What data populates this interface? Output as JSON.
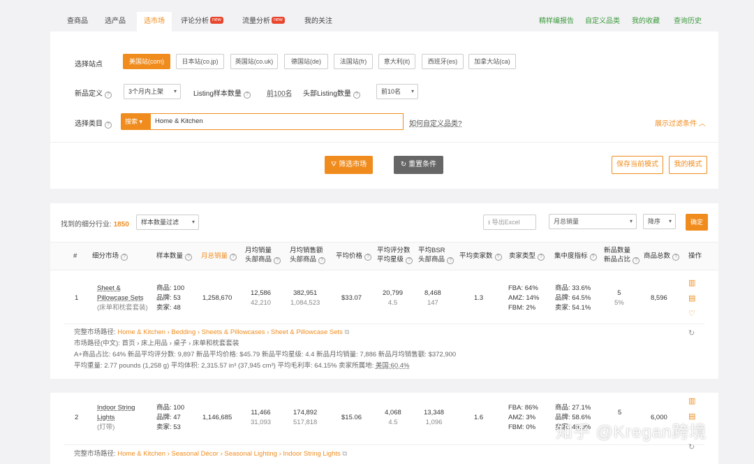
{
  "nav": {
    "tabs": [
      "查商品",
      "选产品",
      "选市场",
      "评论分析",
      "流量分析",
      "我的关注"
    ],
    "new_badge": "new",
    "links": [
      "精样编报告",
      "自定义品类",
      "我的收藏",
      "查询历史"
    ]
  },
  "filters": {
    "site_label": "选择站点",
    "sites": [
      "美国站(com)",
      "日本站(co.jp)",
      "英国站(co.uk)",
      "德国站(de)",
      "法国站(fr)",
      "意大利(it)",
      "西班牙(es)",
      "加拿大站(ca)"
    ],
    "newdef_label": "新品定义",
    "newdef_value": "3个月内上架",
    "sample_label": "Listing样本数量",
    "sample_value": "前100名",
    "head_label": "头部Listing数量",
    "head_value": "前10名",
    "category_label": "选择类目",
    "search_btn": "搜索",
    "category_value": "Home & Kitchen",
    "custom_category_link": "如何自定义品类?",
    "show_filter_link": "展示过滤条件",
    "filter_market_btn": "筛选市场",
    "reset_btn": "重置条件",
    "save_mode_btn": "保存当前模式",
    "my_mode_btn": "我的模式"
  },
  "results": {
    "found_prefix": "找到的细分行业: ",
    "found_count": "1850",
    "sample_filter": "样本数量过滤",
    "export_label": "导出Excel",
    "sort_field": "月总销量",
    "sort_order": "降序",
    "confirm_btn": "确定"
  },
  "table": {
    "headers": {
      "idx": "#",
      "market": "细分市场",
      "sample": "样本数量",
      "monthly_sales": "月总销量",
      "avg_sales_1": "月均销量",
      "avg_sales_2": "头部商品",
      "avg_rev_1": "月均销售额",
      "avg_rev_2": "头部商品",
      "avg_price": "平均价格",
      "avg_reviews_1": "平均评分数",
      "avg_reviews_2": "平均星级",
      "avg_bsr_1": "平均BSR",
      "avg_bsr_2": "头部商品",
      "avg_sellers": "平均卖家数",
      "seller_type": "卖家类型",
      "concentration": "集中度指标",
      "new_1": "新品数量",
      "new_2": "新品占比",
      "total": "商品总数",
      "action": "操作"
    },
    "rows": [
      {
        "idx": "1",
        "name_1": "Sheet &",
        "name_2": "Pillowcase Sets",
        "name_cn": "(床单和枕套套装)",
        "sample_goods": "商品: 100",
        "sample_brands": "品牌: 53",
        "sample_sellers": "卖家: 48",
        "monthly_sales": "1,258,670",
        "avg_sales": "12,586",
        "avg_sales_head": "42,210",
        "avg_rev": "382,951",
        "avg_rev_head": "1,084,523",
        "avg_price": "$33.07",
        "avg_reviews": "20,799",
        "avg_rating": "4.5",
        "avg_bsr": "8,468",
        "avg_bsr_head": "147",
        "avg_sellers": "1.3",
        "fba": "FBA: 64%",
        "amz": "AMZ: 14%",
        "fbm": "FBM: 2%",
        "conc_goods": "商品: 33.6%",
        "conc_brands": "品牌: 64.5%",
        "conc_sellers": "卖家: 54.1%",
        "new_count": "5",
        "new_ratio": "5%",
        "total": "8,596",
        "path_label": "完整市场路径: ",
        "path": "Home & Kitchen › Bedding › Sheets & Pillowcases › Sheet & Pillowcase Sets",
        "path_cn": "市场路径(中文): 首页 › 床上用品 › 桌子 › 床单和枕套套装",
        "stats_1": "A+商品占比: 64%    新品平均评分数: 9,897    新品平均价格: $45.79    新品平均星级: 4.4    新品月均销量: 7,886    新品月均销售额: $372,900",
        "stats_2": "平均重量: 2.77 pounds (1,258 g)    平均体积: 2,315.57 in³ (37,945 cm³)    平均毛利率: 64.15%    ",
        "seller_loc_label": "卖家所属地: ",
        "seller_loc": "美国:60.4%"
      },
      {
        "idx": "2",
        "name_1": "Indoor String",
        "name_2": "Lights",
        "name_cn": "(灯带)",
        "sample_goods": "商品: 100",
        "sample_brands": "品牌: 47",
        "sample_sellers": "卖家: 53",
        "monthly_sales": "1,146,685",
        "avg_sales": "11,466",
        "avg_sales_head": "31,093",
        "avg_rev": "174,892",
        "avg_rev_head": "517,818",
        "avg_price": "$15.06",
        "avg_reviews": "4,068",
        "avg_rating": "4.5",
        "avg_bsr": "13,348",
        "avg_bsr_head": "1,096",
        "avg_sellers": "1.6",
        "fba": "FBA: 86%",
        "amz": "AMZ: 3%",
        "fbm": "FBM: 0%",
        "conc_goods": "商品: 27.1%",
        "conc_brands": "品牌: 58.6%",
        "conc_sellers": "卖家: 49.0%",
        "new_count": "5",
        "total": "6,000",
        "path_label": "完整市场路径: ",
        "path": "Home & Kitchen › Seasonal Décor › Seasonal Lighting › Indoor String Lights"
      }
    ]
  },
  "watermark": "知乎 @Kregan跨境",
  "colors": {
    "accent": "#f08c1e",
    "link_green": "#3c9a3c",
    "badge_red": "#e8452c"
  }
}
